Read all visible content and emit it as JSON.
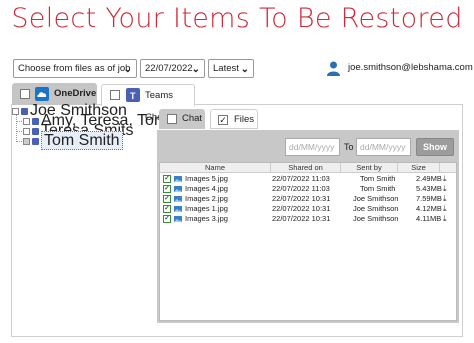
{
  "page": {
    "title": "Select Your Items To Be Restored"
  },
  "toolbar": {
    "mode_select": "Choose from files as of job",
    "date_select": "22/07/2022",
    "version_select": "Latest",
    "user_email": "joe.smithson@lebshama.com"
  },
  "tabs": [
    {
      "label": "OneDrive",
      "active": true
    },
    {
      "label": "Teams Chat",
      "active": false
    }
  ],
  "tree": [
    {
      "label": "Joe Smithson"
    },
    {
      "label": "Amy, Teresa, Tom"
    },
    {
      "label": "Teresa Smits"
    },
    {
      "label": "Tom Smith",
      "selected": true
    }
  ],
  "inner_tabs": [
    {
      "label": "Chat",
      "checked": false
    },
    {
      "label": "Files",
      "checked": true
    }
  ],
  "filter": {
    "from_placeholder": "dd/MM/yyyy",
    "to_label": "To",
    "to_placeholder": "dd/MM/yyyy",
    "show_label": "Show"
  },
  "files": {
    "columns": [
      "Name",
      "Shared on",
      "Sent by",
      "Size"
    ],
    "rows": [
      {
        "name": "Images 5.jpg",
        "shared_on": "22/07/2022 11:03",
        "sent_by": "Tom Smith",
        "size": "2.49MB"
      },
      {
        "name": "Images 4.jpg",
        "shared_on": "22/07/2022 11:03",
        "sent_by": "Tom Smith",
        "size": "5.43MB"
      },
      {
        "name": "Images 2.jpg",
        "shared_on": "22/07/2022 10:31",
        "sent_by": "Joe Smithson",
        "size": "7.59MB"
      },
      {
        "name": "Images 1.jpg",
        "shared_on": "22/07/2022 10:31",
        "sent_by": "Joe Smithson",
        "size": "4.12MB"
      },
      {
        "name": "Images 3.jpg",
        "shared_on": "22/07/2022 10:31",
        "sent_by": "Joe Smithson",
        "size": "4.11MB"
      }
    ]
  },
  "colors": {
    "title": "#cf2a3a",
    "teams": "#4a5fb8",
    "onedrive": "#1a73c8"
  }
}
